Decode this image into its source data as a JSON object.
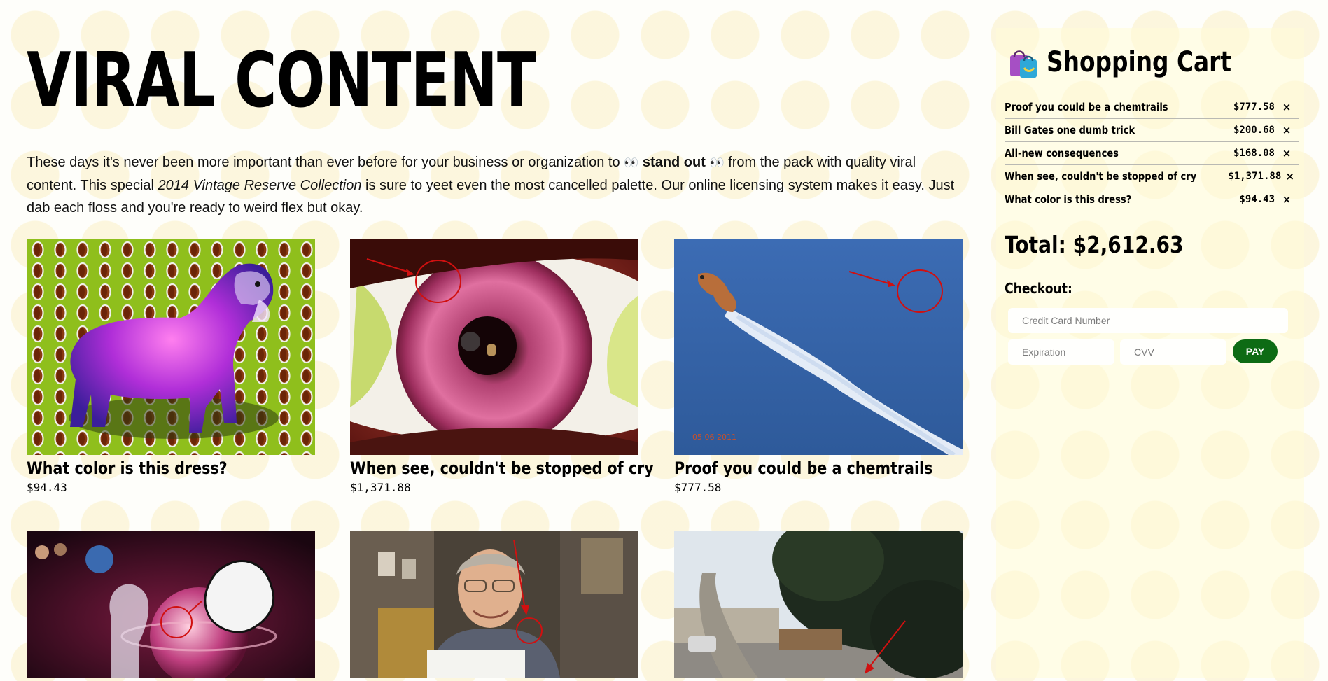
{
  "page": {
    "title": "VIRAL CONTENT",
    "intro": {
      "part1": "These days it's never been more important than ever before for your business or organization to",
      "eyes_left": "👀",
      "emphasis": "stand out",
      "eyes_right": "👀",
      "part2": "from the pack with quality viral content. This special",
      "collection": "2014 Vintage Reserve Collection",
      "part3": "is sure to yeet even the most cancelled palette. Our online licensing system makes it easy. Just dab each floss and you're ready to weird flex but okay."
    }
  },
  "products": [
    {
      "title": "What color is this dress?",
      "price": "$94.43"
    },
    {
      "title": "When see, couldn't be stopped of cry",
      "price": "$1,371.88"
    },
    {
      "title": "Proof you could be a chemtrails",
      "price": "$777.58",
      "image_date": "05 06 2011"
    },
    {
      "title": "",
      "price": ""
    },
    {
      "title": "",
      "price": ""
    },
    {
      "title": "",
      "price": ""
    }
  ],
  "cart": {
    "icon": "shopping-bags-icon",
    "title": "Shopping Cart",
    "items": [
      {
        "name": "Proof you could be a chemtrails",
        "price": "$777.58",
        "remove": "×"
      },
      {
        "name": "Bill Gates one dumb trick",
        "price": "$200.68",
        "remove": "×"
      },
      {
        "name": "All-new consequences",
        "price": "$168.08",
        "remove": "×"
      },
      {
        "name": "When see, couldn't be stopped of cry",
        "price": "$1,371.88",
        "remove": "×"
      },
      {
        "name": "What color is this dress?",
        "price": "$94.43",
        "remove": "×"
      }
    ],
    "total": "Total: $2,612.63",
    "checkout_label": "Checkout:",
    "card_placeholder": "Credit Card Number",
    "expiration_placeholder": "Expiration",
    "cvv_placeholder": "CVV",
    "pay_label": "PAY"
  },
  "colors": {
    "pay_button": "#0d6b14",
    "background_emoji": "#f6dc78"
  }
}
